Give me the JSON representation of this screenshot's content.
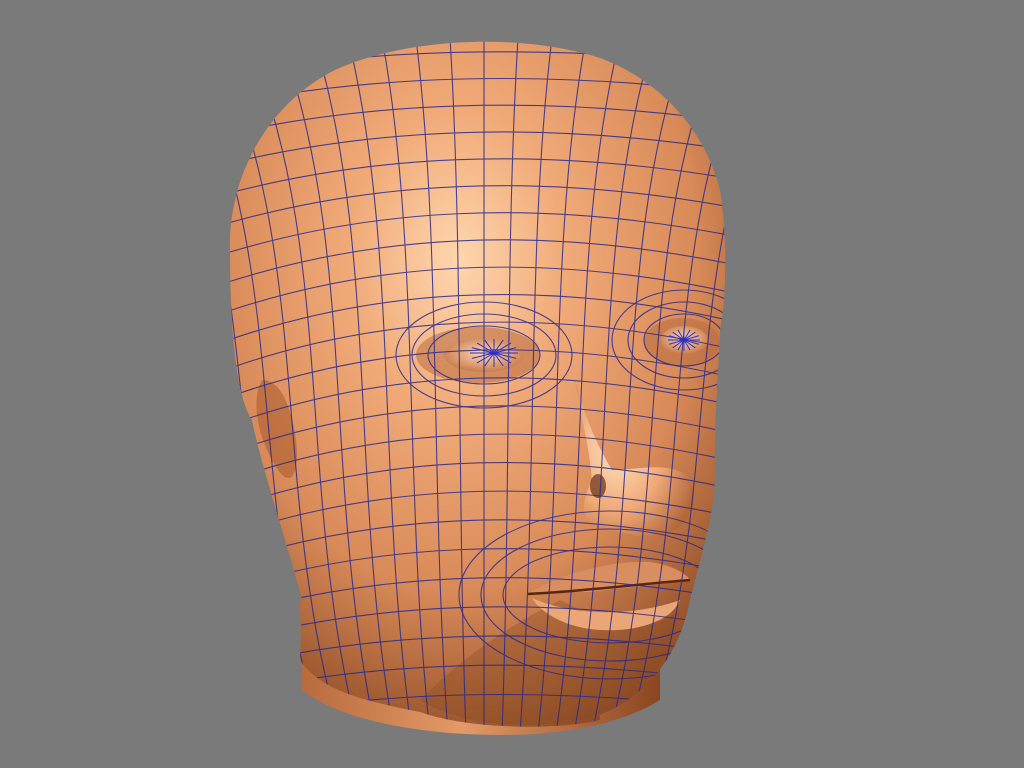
{
  "viewport": {
    "background_color": "#7a7a7a",
    "subject": "head-mesh",
    "mesh": {
      "skin_color": "#e8a070",
      "skin_highlight": "#ffd2a8",
      "skin_shadow": "#7a3c1a",
      "wire_color": "#2c2a8a",
      "pole_color": "#3030c0"
    }
  }
}
